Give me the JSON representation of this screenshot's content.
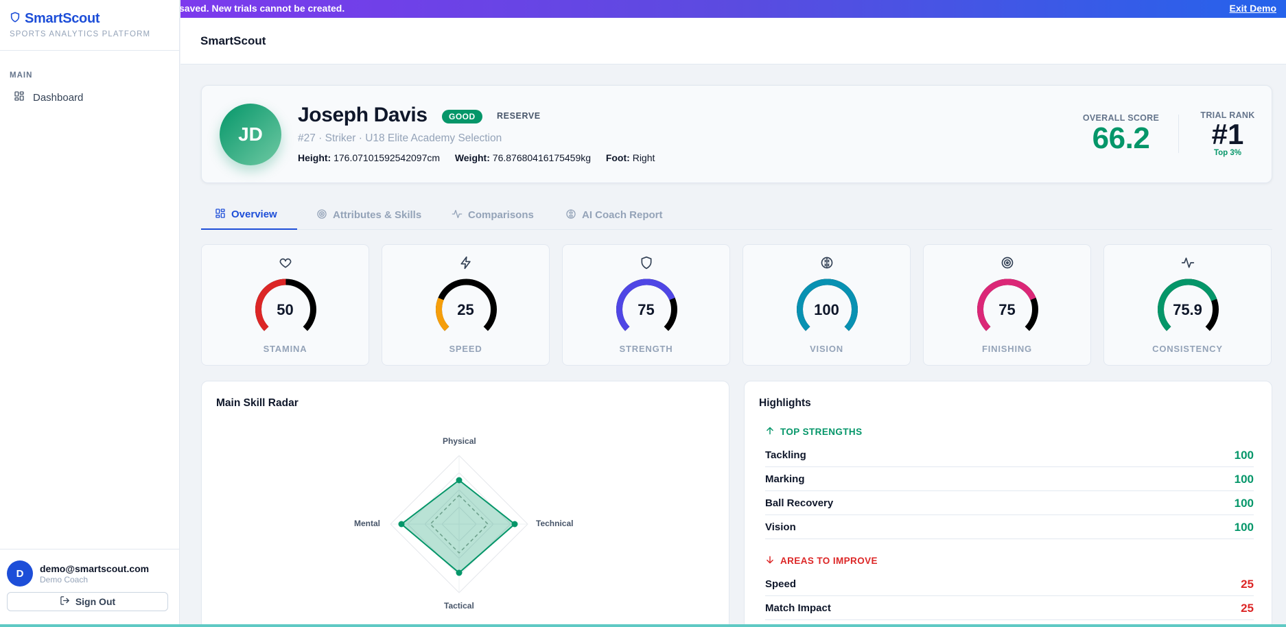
{
  "app": {
    "brand": "SmartScout",
    "brand_sub": "SPORTS ANALYTICS PLATFORM",
    "header_title": "SmartScout"
  },
  "banner": {
    "text": "saved. New trials cannot be created.",
    "exit_label": "Exit Demo"
  },
  "sidebar": {
    "section_label": "MAIN",
    "items": [
      {
        "label": "Dashboard",
        "icon": "dashboard-grid-icon"
      }
    ]
  },
  "user": {
    "initial": "D",
    "email": "demo@smartscout.com",
    "role": "Demo Coach",
    "signout_label": "Sign Out"
  },
  "player": {
    "initials": "JD",
    "name": "Joseph Davis",
    "rating_badge": "GOOD",
    "status": "RESERVE",
    "subtitle": "#27 · Striker · U18 Elite Academy Selection",
    "height_label": "Height:",
    "height_value": "176.07101592542097cm",
    "weight_label": "Weight:",
    "weight_value": "76.87680416175459kg",
    "foot_label": "Foot:",
    "foot_value": "Right",
    "overall_label": "OVERALL SCORE",
    "overall_value": "66.2",
    "rank_label": "TRIAL RANK",
    "rank_value": "#1",
    "rank_sub": "Top 3%"
  },
  "tabs": [
    {
      "label": "Overview",
      "icon": "grid-icon",
      "active": true
    },
    {
      "label": "Attributes & Skills",
      "icon": "target-icon",
      "active": false
    },
    {
      "label": "Comparisons",
      "icon": "activity-icon",
      "active": false
    },
    {
      "label": "AI Coach Report",
      "icon": "brain-icon",
      "active": false
    }
  ],
  "stats": [
    {
      "label": "STAMINA",
      "value": "50",
      "fraction": 0.5,
      "color": "#dc2626",
      "icon": "heart-icon"
    },
    {
      "label": "SPEED",
      "value": "25",
      "fraction": 0.25,
      "color": "#f59e0b",
      "icon": "zap-icon"
    },
    {
      "label": "STRENGTH",
      "value": "75",
      "fraction": 0.75,
      "color": "#4f46e5",
      "icon": "shield-icon"
    },
    {
      "label": "VISION",
      "value": "100",
      "fraction": 1.0,
      "color": "#0891b2",
      "icon": "brain-icon"
    },
    {
      "label": "FINISHING",
      "value": "75",
      "fraction": 0.75,
      "color": "#db2777",
      "icon": "target-icon"
    },
    {
      "label": "CONSISTENCY",
      "value": "75.9",
      "fraction": 0.759,
      "color": "#059669",
      "icon": "activity-icon"
    }
  ],
  "radar": {
    "title": "Main Skill Radar",
    "axes": [
      "Physical",
      "Technical",
      "Tactical",
      "Mental"
    ],
    "values": [
      0.64,
      0.81,
      0.71,
      0.84
    ],
    "max": 1,
    "color": "#059669"
  },
  "highlights": {
    "title": "Highlights",
    "strengths_label": "TOP STRENGTHS",
    "strengths": [
      {
        "name": "Tackling",
        "value": "100"
      },
      {
        "name": "Marking",
        "value": "100"
      },
      {
        "name": "Ball Recovery",
        "value": "100"
      },
      {
        "name": "Vision",
        "value": "100"
      }
    ],
    "improve_label": "AREAS TO IMPROVE",
    "improve": [
      {
        "name": "Speed",
        "value": "25"
      },
      {
        "name": "Match Impact",
        "value": "25"
      }
    ],
    "strength_color": "#059669",
    "improve_color": "#dc2626"
  }
}
